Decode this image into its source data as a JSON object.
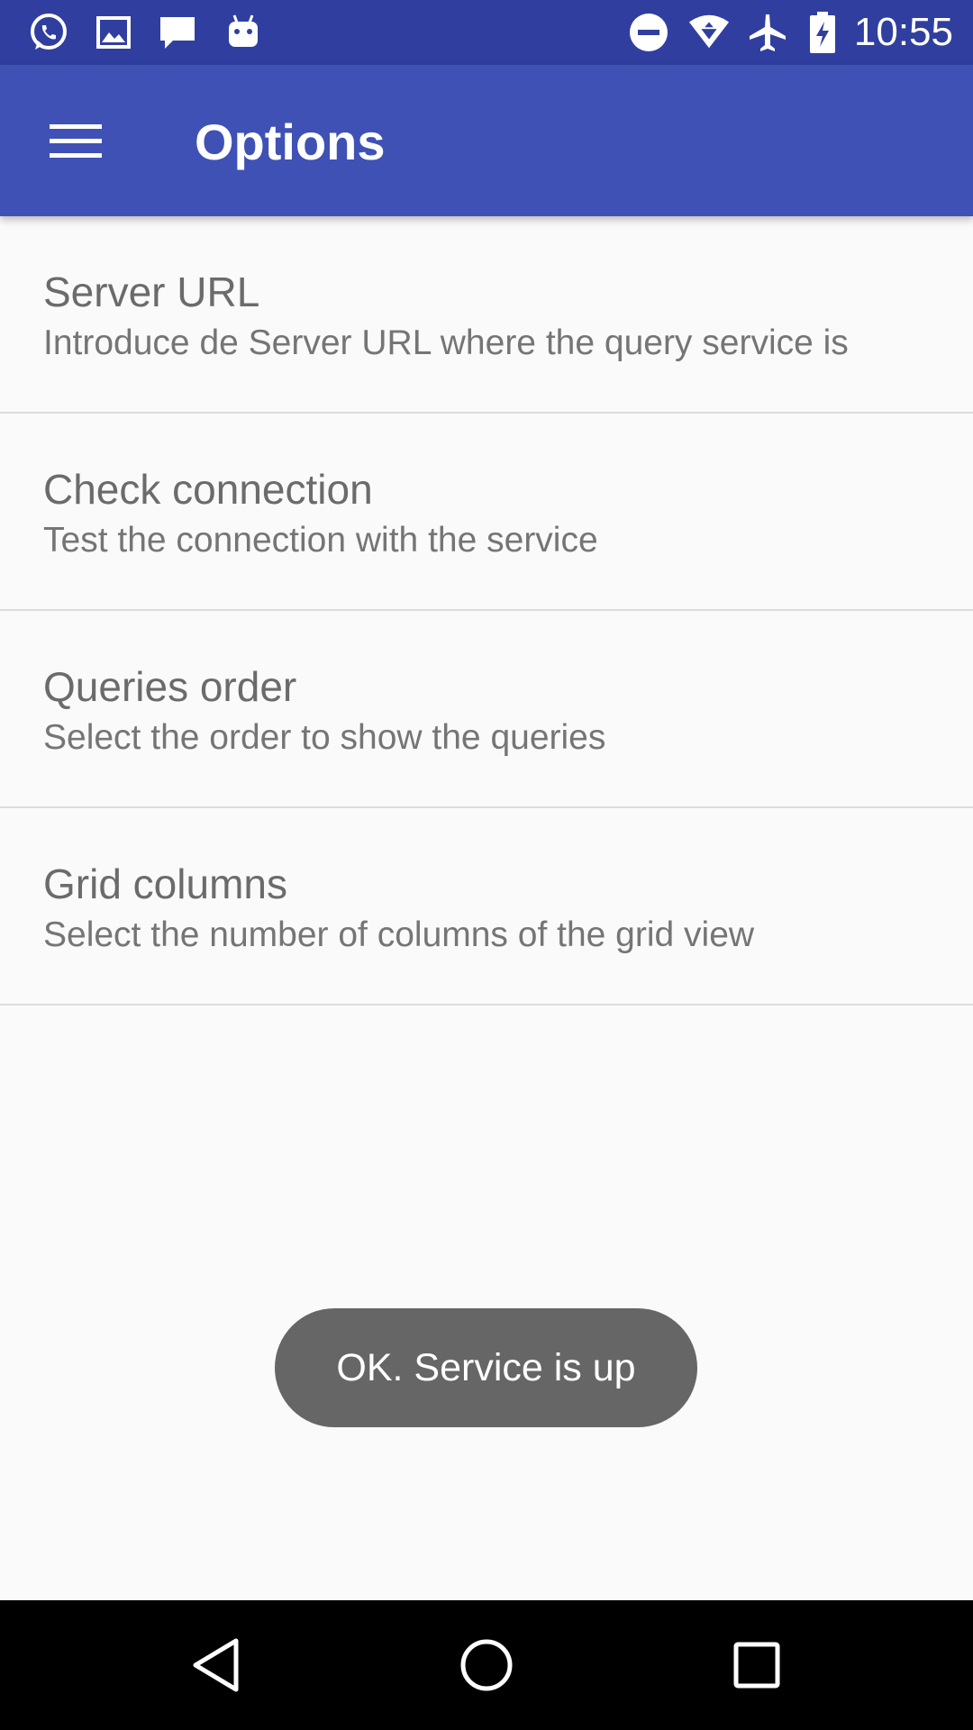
{
  "status_bar": {
    "time": "10:55",
    "left_icons": [
      "whatsapp-icon",
      "image-icon",
      "message-icon",
      "android-icon"
    ],
    "right_icons": [
      "do-not-disturb-icon",
      "wifi-icon",
      "airplane-mode-icon",
      "battery-charging-icon"
    ],
    "color": "#303f9f"
  },
  "app_bar": {
    "title": "Options",
    "color": "#3f51b5"
  },
  "preferences": [
    {
      "title": "Server URL",
      "summary": "Introduce de Server URL where the query service is"
    },
    {
      "title": "Check connection",
      "summary": "Test the connection with the service"
    },
    {
      "title": "Queries order",
      "summary": "Select the order to show the queries"
    },
    {
      "title": "Grid columns",
      "summary": "Select the number of columns of the grid view"
    }
  ],
  "toast": {
    "message": "OK. Service is up"
  },
  "nav_bar": {
    "buttons": [
      "back-icon",
      "home-icon",
      "recents-icon"
    ]
  }
}
